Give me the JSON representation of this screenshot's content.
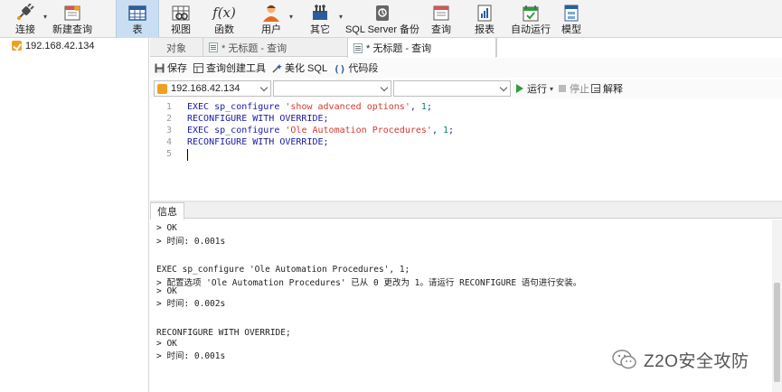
{
  "toolbar": {
    "items": [
      {
        "label": "连接",
        "icon": "plug-icon"
      },
      {
        "label": "新建查询",
        "icon": "new-query-icon"
      },
      {
        "label": "表",
        "icon": "table-icon",
        "active": true
      },
      {
        "label": "视图",
        "icon": "view-icon"
      },
      {
        "label": "函数",
        "icon": "function-icon",
        "glyph": "f(x)"
      },
      {
        "label": "用户",
        "icon": "user-icon"
      },
      {
        "label": "其它",
        "icon": "tools-icon"
      },
      {
        "label": "SQL Server 备份",
        "icon": "backup-icon"
      },
      {
        "label": "查询",
        "icon": "query-icon"
      },
      {
        "label": "报表",
        "icon": "report-icon"
      },
      {
        "label": "自动运行",
        "icon": "autorun-icon"
      },
      {
        "label": "模型",
        "icon": "model-icon"
      }
    ]
  },
  "sidebar": {
    "connection": "192.168.42.134"
  },
  "tabs": {
    "objects": "对象",
    "tab1": "* 无标题 - 查询",
    "tab2": "* 无标题 - 查询"
  },
  "editor_toolbar": {
    "save": "保存",
    "query_builder": "查询创建工具",
    "beautify": "美化 SQL",
    "snippet": "代码段"
  },
  "selectors": {
    "connection": "192.168.42.134",
    "database": "",
    "schema": ""
  },
  "run_controls": {
    "run": "运行",
    "stop": "停止",
    "explain": "解释"
  },
  "editor": {
    "lines": [
      {
        "n": "1",
        "parts": [
          [
            "kw",
            "EXEC "
          ],
          [
            "kw",
            "sp_configure "
          ],
          [
            "str",
            "'show advanced options'"
          ],
          [
            "kw",
            ", "
          ],
          [
            "num",
            "1"
          ],
          [
            "kw",
            ";"
          ]
        ]
      },
      {
        "n": "2",
        "parts": [
          [
            "kw",
            "RECONFIGURE WITH OVERRIDE;"
          ]
        ]
      },
      {
        "n": "3",
        "parts": [
          [
            "kw",
            "EXEC "
          ],
          [
            "kw",
            "sp_configure "
          ],
          [
            "str",
            "'Ole Automation Procedures'"
          ],
          [
            "kw",
            ", "
          ],
          [
            "num",
            "1"
          ],
          [
            "kw",
            ";"
          ]
        ]
      },
      {
        "n": "4",
        "parts": [
          [
            "kw",
            "RECONFIGURE WITH OVERRIDE;"
          ]
        ]
      },
      {
        "n": "5",
        "parts": []
      }
    ]
  },
  "results": {
    "tab": "信息",
    "lines": [
      "> OK",
      "> 时间: 0.001s",
      "",
      "",
      "EXEC sp_configure 'Ole Automation Procedures', 1;",
      "> 配置选项 'Ole Automation Procedures' 已从 0 更改为 1。请运行 RECONFIGURE 语句进行安装。",
      "> OK",
      "> 时间: 0.002s",
      "",
      "",
      "RECONFIGURE WITH OVERRIDE;",
      "> OK",
      "> 时间: 0.001s"
    ]
  },
  "watermark": {
    "text": "Z2O安全攻防"
  },
  "colors": {
    "active_tab_bg": "#c9def2",
    "keyword": "#1a1aa6",
    "string": "#d43a2f",
    "number": "#098658",
    "run_green": "#2e9e3e"
  }
}
